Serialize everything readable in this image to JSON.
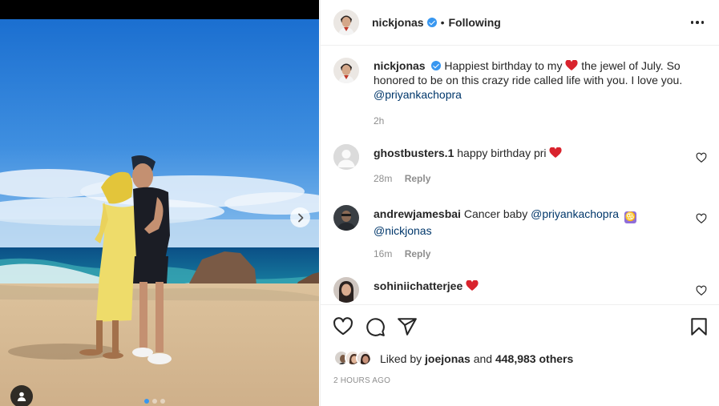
{
  "post": {
    "author": "nickjonas",
    "follow_state": "Following",
    "separator": "•"
  },
  "caption": {
    "username": "nickjonas",
    "text_before_emoji": "Happiest birthday to my",
    "text_after_emoji": "the jewel of July. So honored to be on this crazy ride called life with you. I love you.",
    "mention": "@priyankachopra",
    "time": "2h"
  },
  "comments": [
    {
      "username": "ghostbusters.1",
      "text": "happy birthday pri",
      "time": "28m",
      "reply_label": "Reply"
    },
    {
      "username": "andrewjamesbai",
      "text": "Cancer baby",
      "mention_1": "@priyankachopra",
      "emoji": "♋",
      "mention_2": "@nickjonas",
      "time": "16m",
      "reply_label": "Reply"
    },
    {
      "username": "sohiniichatterjee"
    }
  ],
  "likes": {
    "prefix": "Liked by",
    "first_liker": "joejonas",
    "middle": "and",
    "others": "448,983 others"
  },
  "timestamp": "2 HOURS AGO",
  "colors": {
    "verified_blue": "#3897f0",
    "mention_blue": "#00376b",
    "heart_red": "#ed4956",
    "secondary_text": "#8e8e8e"
  },
  "icons": [
    "verified-icon",
    "more-icon",
    "heart-icon",
    "comment-icon",
    "share-icon",
    "save-icon",
    "chevron-right-icon",
    "person-tag-icon"
  ]
}
